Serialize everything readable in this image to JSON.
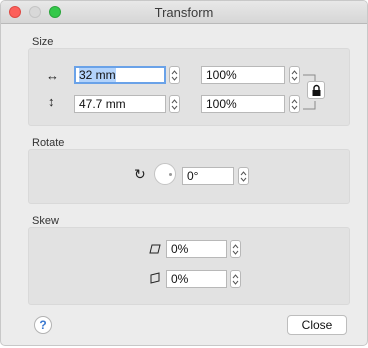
{
  "window": {
    "title": "Transform"
  },
  "size": {
    "label": "Size",
    "width_value": "32 mm",
    "height_value": "47.7 mm",
    "width_percent": "100%",
    "height_percent": "100%"
  },
  "rotate": {
    "label": "Rotate",
    "value": "0°"
  },
  "skew": {
    "label": "Skew",
    "x_value": "0%",
    "y_value": "0%"
  },
  "footer": {
    "help_label": "?",
    "close_label": "Close"
  },
  "icons": {
    "width": "horizontal-arrows-icon",
    "height": "vertical-arrows-icon",
    "rotate": "rotate-icon",
    "skew_x": "skew-horizontal-icon",
    "skew_y": "skew-vertical-icon",
    "lock": "lock-icon"
  }
}
